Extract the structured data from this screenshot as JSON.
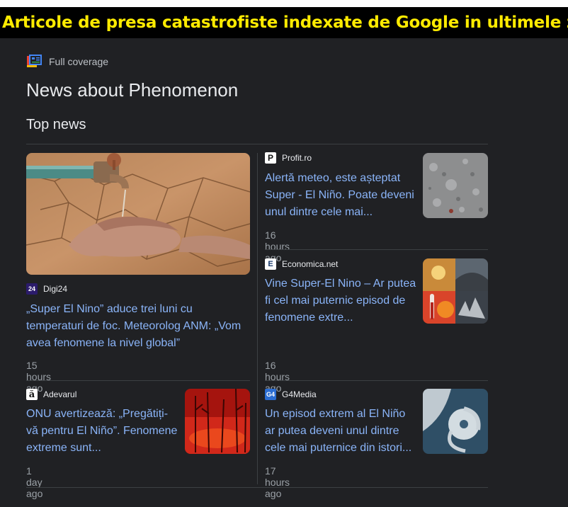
{
  "banner": {
    "text": "Articole de presa catastrofiste indexate de Google in ultimele zile"
  },
  "header": {
    "full_coverage": "Full coverage",
    "title": "News about Phenomenon",
    "section": "Top news"
  },
  "articles": [
    {
      "source": "Digi24",
      "source_logo": "24",
      "title": "„Super El Nino” aduce trei luni cu temperaturi de foc. Meteorolog ANM: „Vom avea fenomene la nivel global”",
      "time": "15 hours ago",
      "image": "water-tap-hands"
    },
    {
      "source": "Profit.ro",
      "source_logo": "P",
      "title": "Alertă meteo, este așteptat Super - El Niño. Poate deveni unul dintre cele mai...",
      "time": "16 hours ago",
      "image": "rain-ground"
    },
    {
      "source": "Economica.net",
      "source_logo": "E",
      "title": "Vine Super-El Nino – Ar putea fi cel mai puternic episod de fenomene extre...",
      "time": "16 hours ago",
      "image": "weather-collage"
    },
    {
      "source": "Adevarul",
      "source_logo": "ă",
      "title": "ONU avertizează: „Pregătiți-vă pentru El Niño”. Fenomene extreme sunt...",
      "time": "1 day ago",
      "image": "forest-fire"
    },
    {
      "source": "G4Media",
      "source_logo": "G4",
      "title": "Un episod extrem al El Niño ar putea deveni unul dintre cele mai puternice din istori...",
      "time": "17 hours ago",
      "image": "satellite-storm"
    }
  ],
  "colors": {
    "background": "#202124",
    "link": "#8ab4f8",
    "banner_text": "#ffeb00"
  }
}
